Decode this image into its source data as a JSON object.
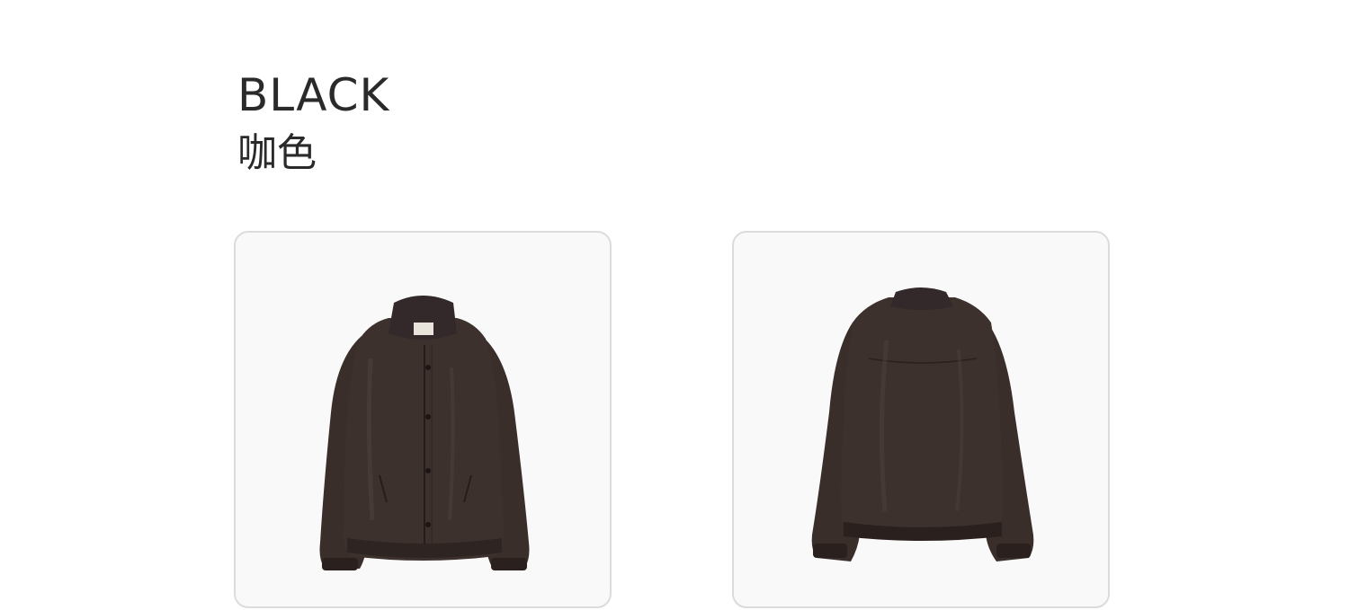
{
  "color_section": {
    "name_en": "BLACK",
    "name_cn": "咖色"
  },
  "images": [
    {
      "view": "front",
      "icon": "jacket-front-image"
    },
    {
      "view": "back",
      "icon": "jacket-back-image"
    }
  ],
  "colors": {
    "jacket": "#3a2e2b",
    "jacket_dark": "#2a201e",
    "card_bg": "#f9f9f9",
    "card_border": "#dcdcdc",
    "text": "#2a2a2a"
  }
}
